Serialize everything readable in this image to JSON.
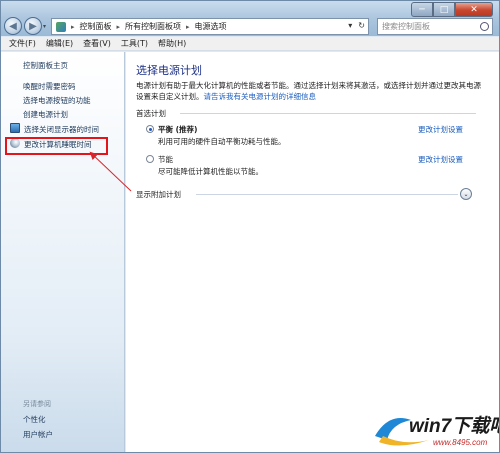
{
  "window": {
    "controls": {
      "minimize": "─",
      "maximize": "□",
      "close": "✕"
    }
  },
  "navigation": {
    "back_icon": "◀",
    "forward_icon": "▶",
    "dropdown_icon": "▾"
  },
  "address": {
    "crumbs": [
      "控制面板",
      "所有控制面板项",
      "电源选项"
    ],
    "separator": "▸",
    "dropdown": "▾",
    "refresh": "↻"
  },
  "search": {
    "placeholder": "搜索控制面板"
  },
  "menu": {
    "items": [
      "文件(F)",
      "编辑(E)",
      "查看(V)",
      "工具(T)",
      "帮助(H)"
    ]
  },
  "sidebar": {
    "home": "控制面板主页",
    "links": [
      "唤醒时需要密码",
      "选择电源按钮的功能",
      "创建电源计划",
      "选择关闭显示器的时间",
      "更改计算机睡眠时间"
    ],
    "see_also_title": "另请参阅",
    "see_also": [
      "个性化",
      "用户帐户"
    ]
  },
  "main": {
    "title": "选择电源计划",
    "description": "电源计划有助于最大化计算机的性能或者节能。通过选择计划来将其激活，或选择计划并通过更改其电源设置来自定义计划。",
    "description_link": "请告诉我有关电源计划的详细信息",
    "preferred_label": "首选计划",
    "plans": [
      {
        "name": "平衡 (推荐)",
        "desc": "利用可用的硬件自动平衡功耗与性能。",
        "link": "更改计划设置",
        "selected": true
      },
      {
        "name": "节能",
        "desc": "尽可能降低计算机性能以节能。",
        "link": "更改计划设置",
        "selected": false
      }
    ],
    "more_plans_label": "显示附加计划",
    "expand_icon": "⌄"
  },
  "watermark": {
    "text": "win7下载吧",
    "url": "www.8495.com"
  },
  "colors": {
    "highlight_box": "#e3151b",
    "link": "#1a5dbf",
    "title": "#1e3287"
  }
}
